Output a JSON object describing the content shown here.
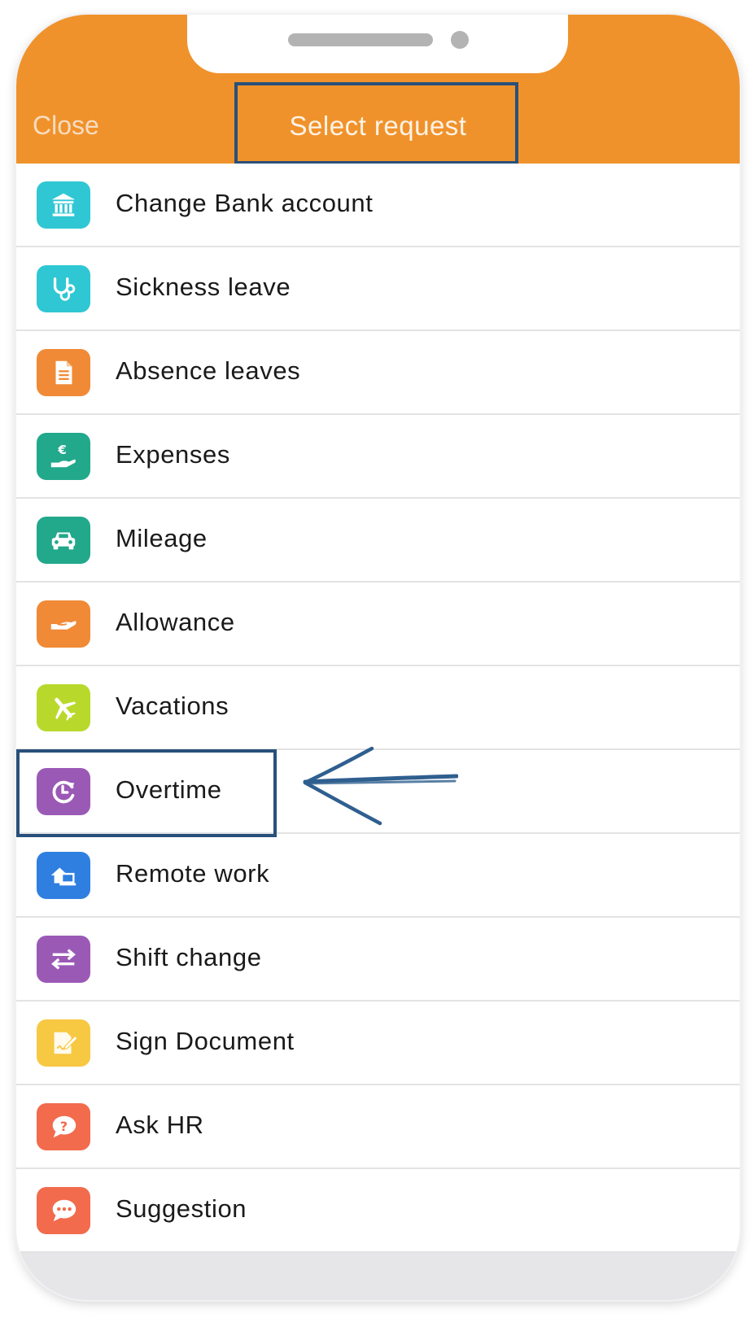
{
  "header": {
    "close_label": "Close",
    "title": "Select request",
    "color": "#f0922b"
  },
  "requests": [
    {
      "label": "Change Bank account",
      "icon": "bank-icon",
      "color": "#2fc7d3"
    },
    {
      "label": "Sickness leave",
      "icon": "stethoscope-icon",
      "color": "#2fc7d3"
    },
    {
      "label": "Absence leaves",
      "icon": "document-icon",
      "color": "#f08a37"
    },
    {
      "label": "Expenses",
      "icon": "euro-hand-icon",
      "color": "#22a88b"
    },
    {
      "label": "Mileage",
      "icon": "car-icon",
      "color": "#22a88b"
    },
    {
      "label": "Allowance",
      "icon": "hand-icon",
      "color": "#f08a37"
    },
    {
      "label": "Vacations",
      "icon": "airplane-icon",
      "color": "#b8d92c"
    },
    {
      "label": "Overtime",
      "icon": "clock-refresh-icon",
      "color": "#9b59b6"
    },
    {
      "label": "Remote work",
      "icon": "home-laptop-icon",
      "color": "#2f7fe0"
    },
    {
      "label": "Shift change",
      "icon": "swap-arrows-icon",
      "color": "#9b59b6"
    },
    {
      "label": "Sign Document",
      "icon": "sign-document-icon",
      "color": "#f7c842"
    },
    {
      "label": "Ask HR",
      "icon": "question-bubble-icon",
      "color": "#f26b4d"
    },
    {
      "label": "Suggestion",
      "icon": "chat-bubble-icon",
      "color": "#f26b4d"
    }
  ],
  "annotation_color": "#29507a"
}
